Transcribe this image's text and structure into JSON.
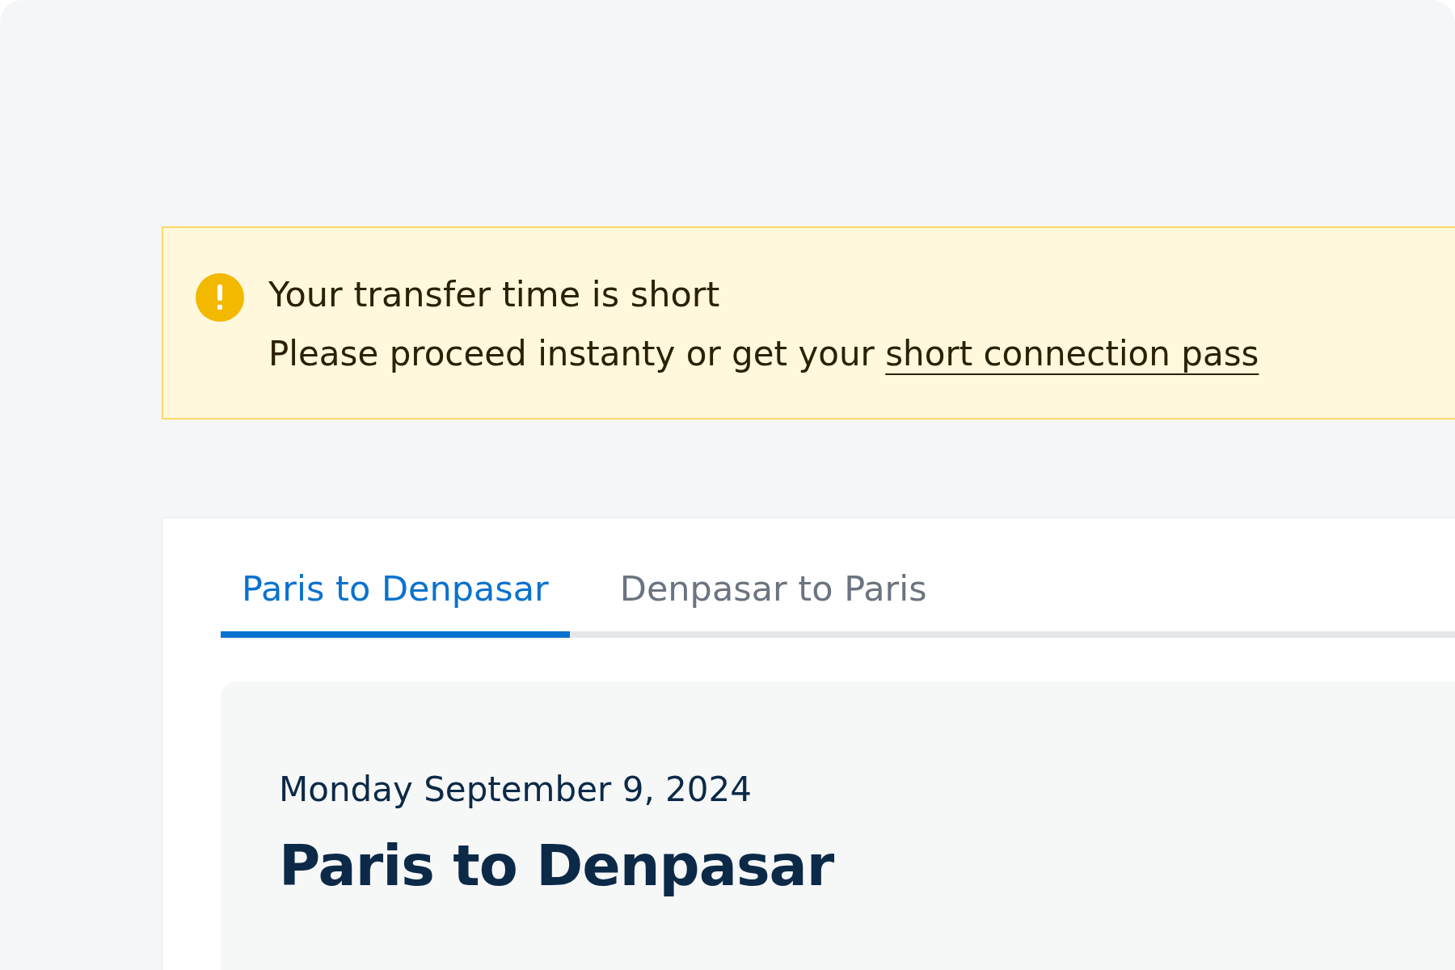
{
  "alert": {
    "kind": "warning",
    "title": "Your transfer time is short",
    "message": "Please proceed instanty or get your ",
    "link": "short connection pass"
  },
  "tabs": [
    {
      "label": "Paris to Denpasar",
      "selected": true
    },
    {
      "label": "Denpasar to Paris",
      "selected": false
    }
  ],
  "trip": {
    "date": "Monday September 9, 2024",
    "title": "Paris to Denpasar"
  }
}
